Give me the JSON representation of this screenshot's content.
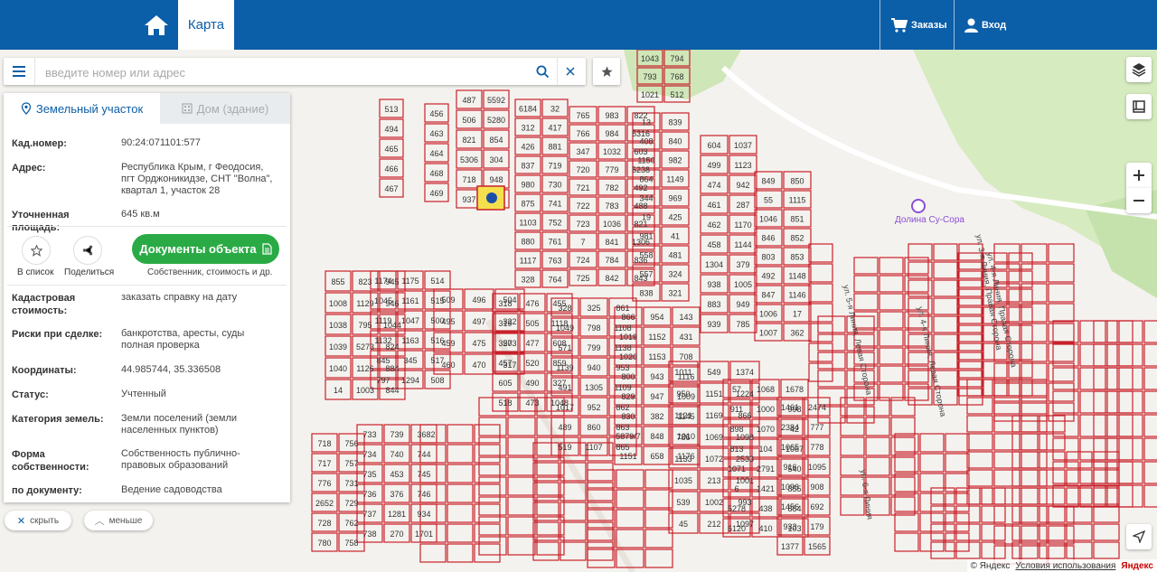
{
  "header": {
    "tab_map": "Карта",
    "orders": "Заказы",
    "login": "Вход"
  },
  "search": {
    "placeholder": "введите номер или адрес"
  },
  "panel": {
    "tab_land": "Земельный участок",
    "tab_house": "Дом (здание)",
    "fields": [
      {
        "label": "Кад.номер:",
        "value": "90:24:071101:577"
      },
      {
        "label": "Адрес:",
        "value": "Республика Крым, г Феодосия, пгт Орджоникидзе, СНТ \"Волна\", квартал 1, участок 28"
      },
      {
        "label": "Уточненная площадь:",
        "value": "645 кв.м"
      },
      {
        "label": "Кадастровая стоимость:",
        "value": "заказать справку на дату"
      },
      {
        "label": "Риски при сделке:",
        "value": "банкротства, аресты, суды"
      },
      {
        "label": "Координаты:",
        "value": "44.985744, 35.336508"
      },
      {
        "label": "Статус:",
        "value": "Учтенный"
      },
      {
        "label": "Категория земель:",
        "value": "Земли поселений (земли населенных пунктов)"
      },
      {
        "label": "Форма собственности:",
        "value": "Собственность публично-правовых образований"
      },
      {
        "label": "по документу:",
        "value": "Ведение садоводства"
      }
    ],
    "risk_link": "полная проверка",
    "to_list": "В список",
    "share": "Поделиться",
    "documents_button": "Документы объекта",
    "documents_sub": "Собственник, стоимость и др."
  },
  "pills": {
    "hide": "скрыть",
    "less": "меньше"
  },
  "map_labels": {
    "parcels": [
      "1043",
      "793",
      "1021",
      "794",
      "768",
      "512",
      "513",
      "494",
      "465",
      "466",
      "467",
      "456",
      "463",
      "464",
      "468",
      "469",
      "487",
      "506",
      "821",
      "5306",
      "718",
      "937",
      "5592",
      "5280",
      "854",
      "304",
      "948",
      "958",
      "6184",
      "312",
      "426",
      "837",
      "980",
      "875",
      "1103",
      "880",
      "1117",
      "328",
      "32",
      "417",
      "881",
      "719",
      "730",
      "741",
      "752",
      "761",
      "763",
      "764",
      "765",
      "766",
      "347",
      "720",
      "721",
      "722",
      "723",
      "7",
      "724",
      "725",
      "983",
      "984",
      "1032",
      "779",
      "782",
      "783",
      "1036",
      "841",
      "784",
      "842",
      "822",
      "5316",
      "603",
      "5238",
      "492",
      "488",
      "821",
      "1306",
      "836",
      "843",
      "13",
      "408",
      "1150",
      "864",
      "344",
      "19",
      "981",
      "558",
      "557",
      "838",
      "839",
      "840",
      "982",
      "1149",
      "969",
      "425",
      "41",
      "481",
      "324",
      "321",
      "604",
      "499",
      "474",
      "461",
      "462",
      "458",
      "1304",
      "938",
      "883",
      "939",
      "1037",
      "1123",
      "942",
      "287",
      "1170",
      "1144",
      "379",
      "1005",
      "949",
      "785",
      "849",
      "55",
      "1046",
      "846",
      "803",
      "492",
      "847",
      "1006",
      "1007",
      "850",
      "1115",
      "851",
      "852",
      "853",
      "1148",
      "1146",
      "17",
      "362",
      "855",
      "1008",
      "1038",
      "1039",
      "1040",
      "14",
      "823",
      "1129",
      "795",
      "5273",
      "1126",
      "1003",
      "945",
      "946",
      "1044",
      "824",
      "884",
      "844",
      "1174",
      "1045",
      "1119",
      "1132",
      "845",
      "797",
      "1175",
      "1161",
      "1047",
      "1163",
      "345",
      "1294",
      "514",
      "515",
      "500",
      "516",
      "517",
      "508",
      "509",
      "495",
      "459",
      "460",
      "496",
      "497",
      "475",
      "470",
      "504",
      "322",
      "573",
      "317",
      "318",
      "319",
      "320",
      "457",
      "605",
      "518",
      "476",
      "505",
      "477",
      "520",
      "490",
      "473",
      "455",
      "1118",
      "608",
      "859",
      "327",
      "1048",
      "328",
      "1049",
      "571",
      "1139",
      "491",
      "1017",
      "489",
      "519",
      "325",
      "798",
      "799",
      "940",
      "1305",
      "952",
      "860",
      "1107",
      "861",
      "1108",
      "1138",
      "953",
      "1109",
      "862",
      "863",
      "865",
      "866",
      "1019",
      "1020",
      "800",
      "829",
      "830",
      "5879/7",
      "1151",
      "954",
      "1152",
      "1153",
      "943",
      "947",
      "382",
      "848",
      "658",
      "143",
      "431",
      "708",
      "1116",
      "1009",
      "1145",
      "1010",
      "1176",
      "1011",
      "950",
      "1121",
      "786",
      "1133",
      "1035",
      "539",
      "45",
      "549",
      "1151",
      "1169",
      "1069",
      "1072",
      "213",
      "1002",
      "212",
      "1374",
      "1224",
      "866",
      "1098",
      "2533",
      "1001",
      "993",
      "1097",
      "57",
      "911",
      "898",
      "813",
      "1071",
      "6",
      "5278",
      "6120",
      "1068",
      "1000",
      "1070",
      "104",
      "2791",
      "1421",
      "438",
      "410",
      "1678",
      "998",
      "42",
      "1067",
      "540",
      "855",
      "854",
      "103",
      "1461",
      "2384",
      "1065",
      "916",
      "1096",
      "1456",
      "933",
      "1377",
      "2474",
      "777",
      "778",
      "1095",
      "908",
      "692",
      "179",
      "1565",
      "718",
      "717",
      "776",
      "2652",
      "728",
      "780",
      "756",
      "757",
      "731",
      "729",
      "762",
      "758",
      "733",
      "734",
      "735",
      "736",
      "737",
      "738",
      "739",
      "740",
      "453",
      "376",
      "1281",
      "270",
      "368",
      "744",
      "745",
      "746",
      "934",
      "1701",
      "2"
    ]
  },
  "streets": [
    "ул. 5-я Линия, Левая Сторона",
    "ул. 6-я Линия",
    "ул. 4-я Линия, Левая Сторона",
    "ул. 4-я Линия, Правая Сторона",
    "ул. 3-я Линия, Правая Сторона"
  ],
  "poi": "Долина Су-Сора",
  "footer": {
    "copyright": "© Яндекс",
    "terms": "Условия использования",
    "brand": "Яндекс"
  },
  "colors": {
    "header": "#0b5ea8",
    "parcel": "#c8202a",
    "button_green": "#2aaa45",
    "selected_parcel": "#f4e04d"
  }
}
